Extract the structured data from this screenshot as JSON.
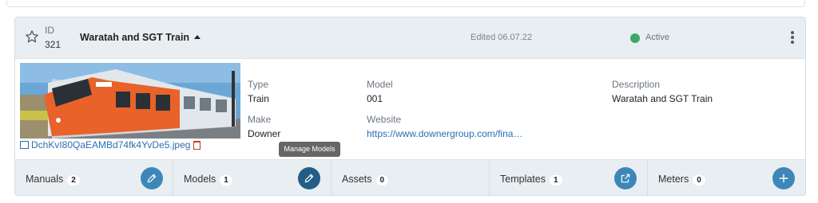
{
  "asset": {
    "id_label": "ID",
    "id_value": "321",
    "title": "Waratah and SGT Train",
    "edited": "Edited 06.07.22",
    "status": "Active",
    "status_color": "#3aa86b",
    "image_file": "DchKvI80QaEAMBd74fk4YvDe5.jpeg"
  },
  "fields": {
    "type_label": "Type",
    "type_value": "Train",
    "model_label": "Model",
    "model_value": "001",
    "description_label": "Description",
    "description_value": "Waratah and SGT Train",
    "make_label": "Make",
    "make_value": "Downer",
    "website_label": "Website",
    "website_value": "https://www.downergroup.com/fina…"
  },
  "tooltip": "Manage Models",
  "tabs": [
    {
      "label": "Manuals",
      "count": "2",
      "action_icon": "pencil-icon"
    },
    {
      "label": "Models",
      "count": "1",
      "action_icon": "pencil-icon"
    },
    {
      "label": "Assets",
      "count": "0"
    },
    {
      "label": "Templates",
      "count": "1",
      "action_icon": "external-link-icon"
    },
    {
      "label": "Meters",
      "count": "0",
      "action_icon": "plus-icon"
    }
  ],
  "colors": {
    "accent": "#3d87b8",
    "accent_dark": "#245d85",
    "link": "#2a6fb0",
    "header_bg": "#e9eef2"
  }
}
